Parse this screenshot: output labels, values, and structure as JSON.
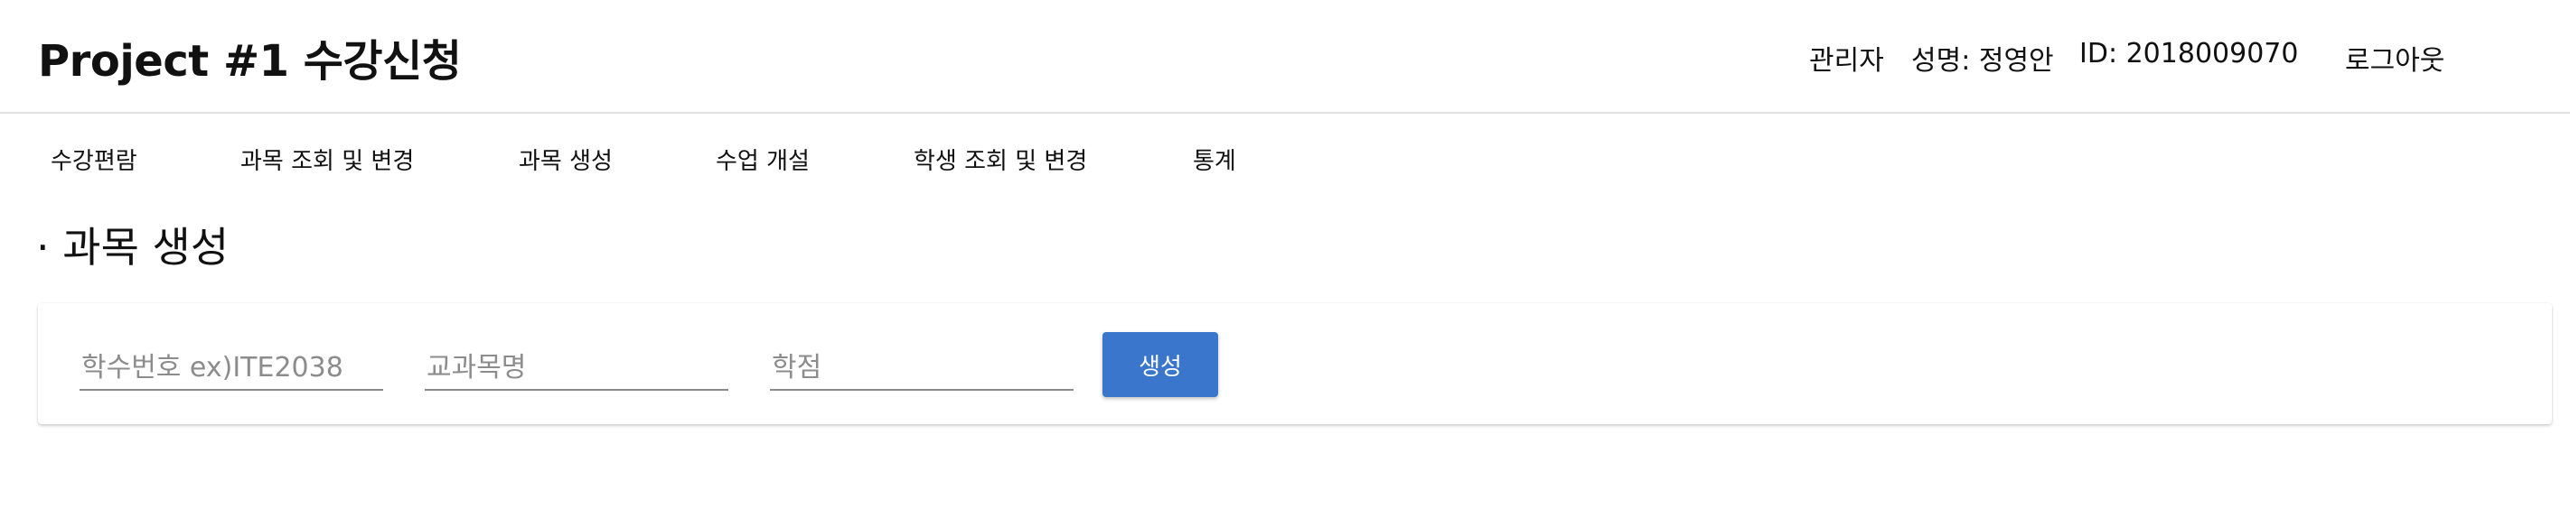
{
  "header": {
    "title": "Project #1 수강신청",
    "user_role": "관리자",
    "user_name": "성명: 정영안",
    "user_id": "ID: 2018009070",
    "logout_label": "로그아웃"
  },
  "nav": {
    "items": [
      {
        "label": "수강편람"
      },
      {
        "label": "과목 조회 및 변경"
      },
      {
        "label": "과목 생성"
      },
      {
        "label": "수업 개설"
      },
      {
        "label": "학생 조회 및 변경"
      },
      {
        "label": "통계"
      }
    ]
  },
  "main": {
    "page_title": "· 과목 생성",
    "form": {
      "course_code": {
        "value": "",
        "placeholder": "학수번호 ex)ITE2038"
      },
      "course_name": {
        "value": "",
        "placeholder": "교과목명"
      },
      "credits": {
        "value": "",
        "placeholder": "학점"
      },
      "submit_label": "생성",
      "submit_color": "#3a76cc"
    }
  }
}
